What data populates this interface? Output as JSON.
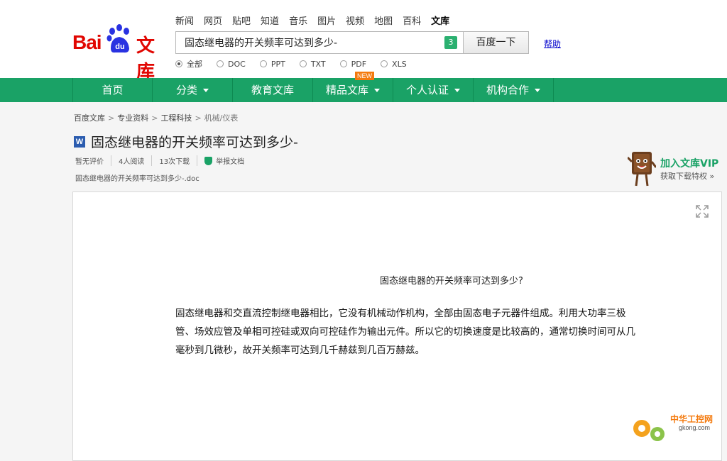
{
  "logo": {
    "bai": "Bai",
    "du": "du",
    "wenku": "文库"
  },
  "topnav": [
    "新闻",
    "网页",
    "贴吧",
    "知道",
    "音乐",
    "图片",
    "视频",
    "地图",
    "百科",
    "文库"
  ],
  "search": {
    "value": "固态继电器的开关频率可达到多少-",
    "badge": "3",
    "button": "百度一下",
    "help": "帮助"
  },
  "filetypes": [
    "全部",
    "DOC",
    "PPT",
    "TXT",
    "PDF",
    "XLS"
  ],
  "mainnav": [
    "首页",
    "分类",
    "教育文库",
    "精品文库",
    "个人认证",
    "机构合作"
  ],
  "new_badge": "NEW",
  "breadcrumb": [
    "百度文库",
    "专业资料",
    "工程科技",
    "机械/仪表"
  ],
  "doc": {
    "icon": "W",
    "title": "固态继电器的开关频率可达到多少-",
    "meta": [
      "暂无评价",
      "4人阅读",
      "13次下载",
      "举报文档"
    ],
    "filename": "固态继电器的开关频率可达到多少-.doc",
    "heading": "固态继电器的开关频率可达到多少?",
    "body": "固态继电器和交直流控制继电器相比，它没有机械动作机构，全部由固态电子元器件组成。利用大功率三极管、场效应管及单相可控硅或双向可控硅作为输出元件。所以它的切换速度是比较高的，通常切换时间可从几毫秒到几微秒，故开关频率可达到几千赫兹到几百万赫兹。"
  },
  "vip": {
    "title": "加入文库VIP",
    "subtitle": "获取下载特权 »"
  },
  "watermark": {
    "line1": "中华工控网",
    "line2": "gkong.com"
  }
}
